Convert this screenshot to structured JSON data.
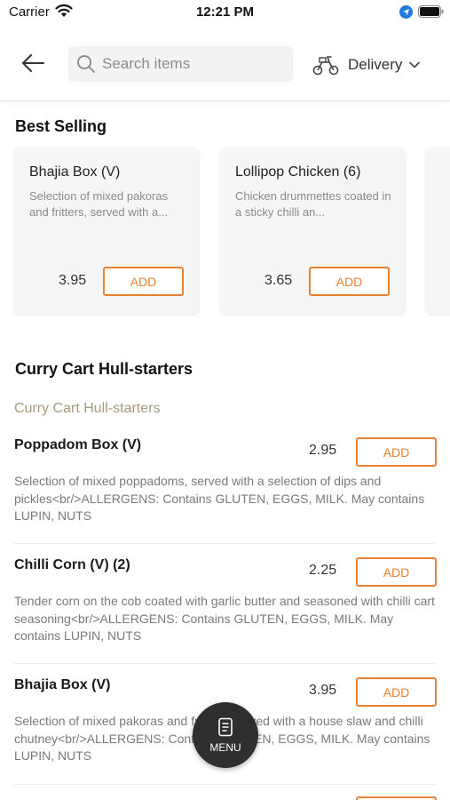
{
  "status_bar": {
    "carrier": "Carrier",
    "time": "12:21 PM"
  },
  "header": {
    "search_placeholder": "Search items",
    "delivery_label": "Delivery",
    "icons": [
      "back-arrow-icon",
      "search-icon",
      "scooter-icon",
      "chevron-down-icon"
    ]
  },
  "best_selling": {
    "title": "Best Selling",
    "cards": [
      {
        "name": "Bhajia Box (V)",
        "description": "Selection of mixed pakoras and fritters, served with a...",
        "price": "3.95",
        "add_label": "ADD"
      },
      {
        "name": "Lollipop Chicken (6)",
        "description": "Chicken drummettes coated in a sticky chilli an...",
        "price": "3.65",
        "add_label": "ADD"
      }
    ]
  },
  "curry_cart": {
    "title": "Curry Cart Hull-starters",
    "category_label": "Curry Cart Hull-starters",
    "items": [
      {
        "name": "Poppadom Box (V)",
        "price": "2.95",
        "add_label": "ADD",
        "description": "Selection of mixed poppadoms, served with a selection of dips and pickles<br/>ALLERGENS: Contains GLUTEN, EGGS, MILK. May contains LUPIN, NUTS"
      },
      {
        "name": "Chilli Corn (V) (2)",
        "price": "2.25",
        "add_label": "ADD",
        "description": "Tender corn on the cob coated with garlic butter and seasoned with chilli cart seasoning<br/>ALLERGENS: Contains GLUTEN, EGGS, MILK. May contains LUPIN, NUTS"
      },
      {
        "name": "Bhajia Box (V)",
        "price": "3.95",
        "add_label": "ADD",
        "description": "Selection of mixed pakoras and fritters, served with a house slaw and chilli chutney<br/>ALLERGENS: Contains GLUTEN, EGGS, MILK. May contains LUPIN, NUTS"
      }
    ]
  },
  "menu_button": {
    "label": "MENU",
    "icon": "menu-book-icon"
  },
  "colors": {
    "accent": "#e88131",
    "category_text": "#a59a78",
    "fab_background": "#2f2f2f",
    "location_blue": "#1f7ae0"
  }
}
